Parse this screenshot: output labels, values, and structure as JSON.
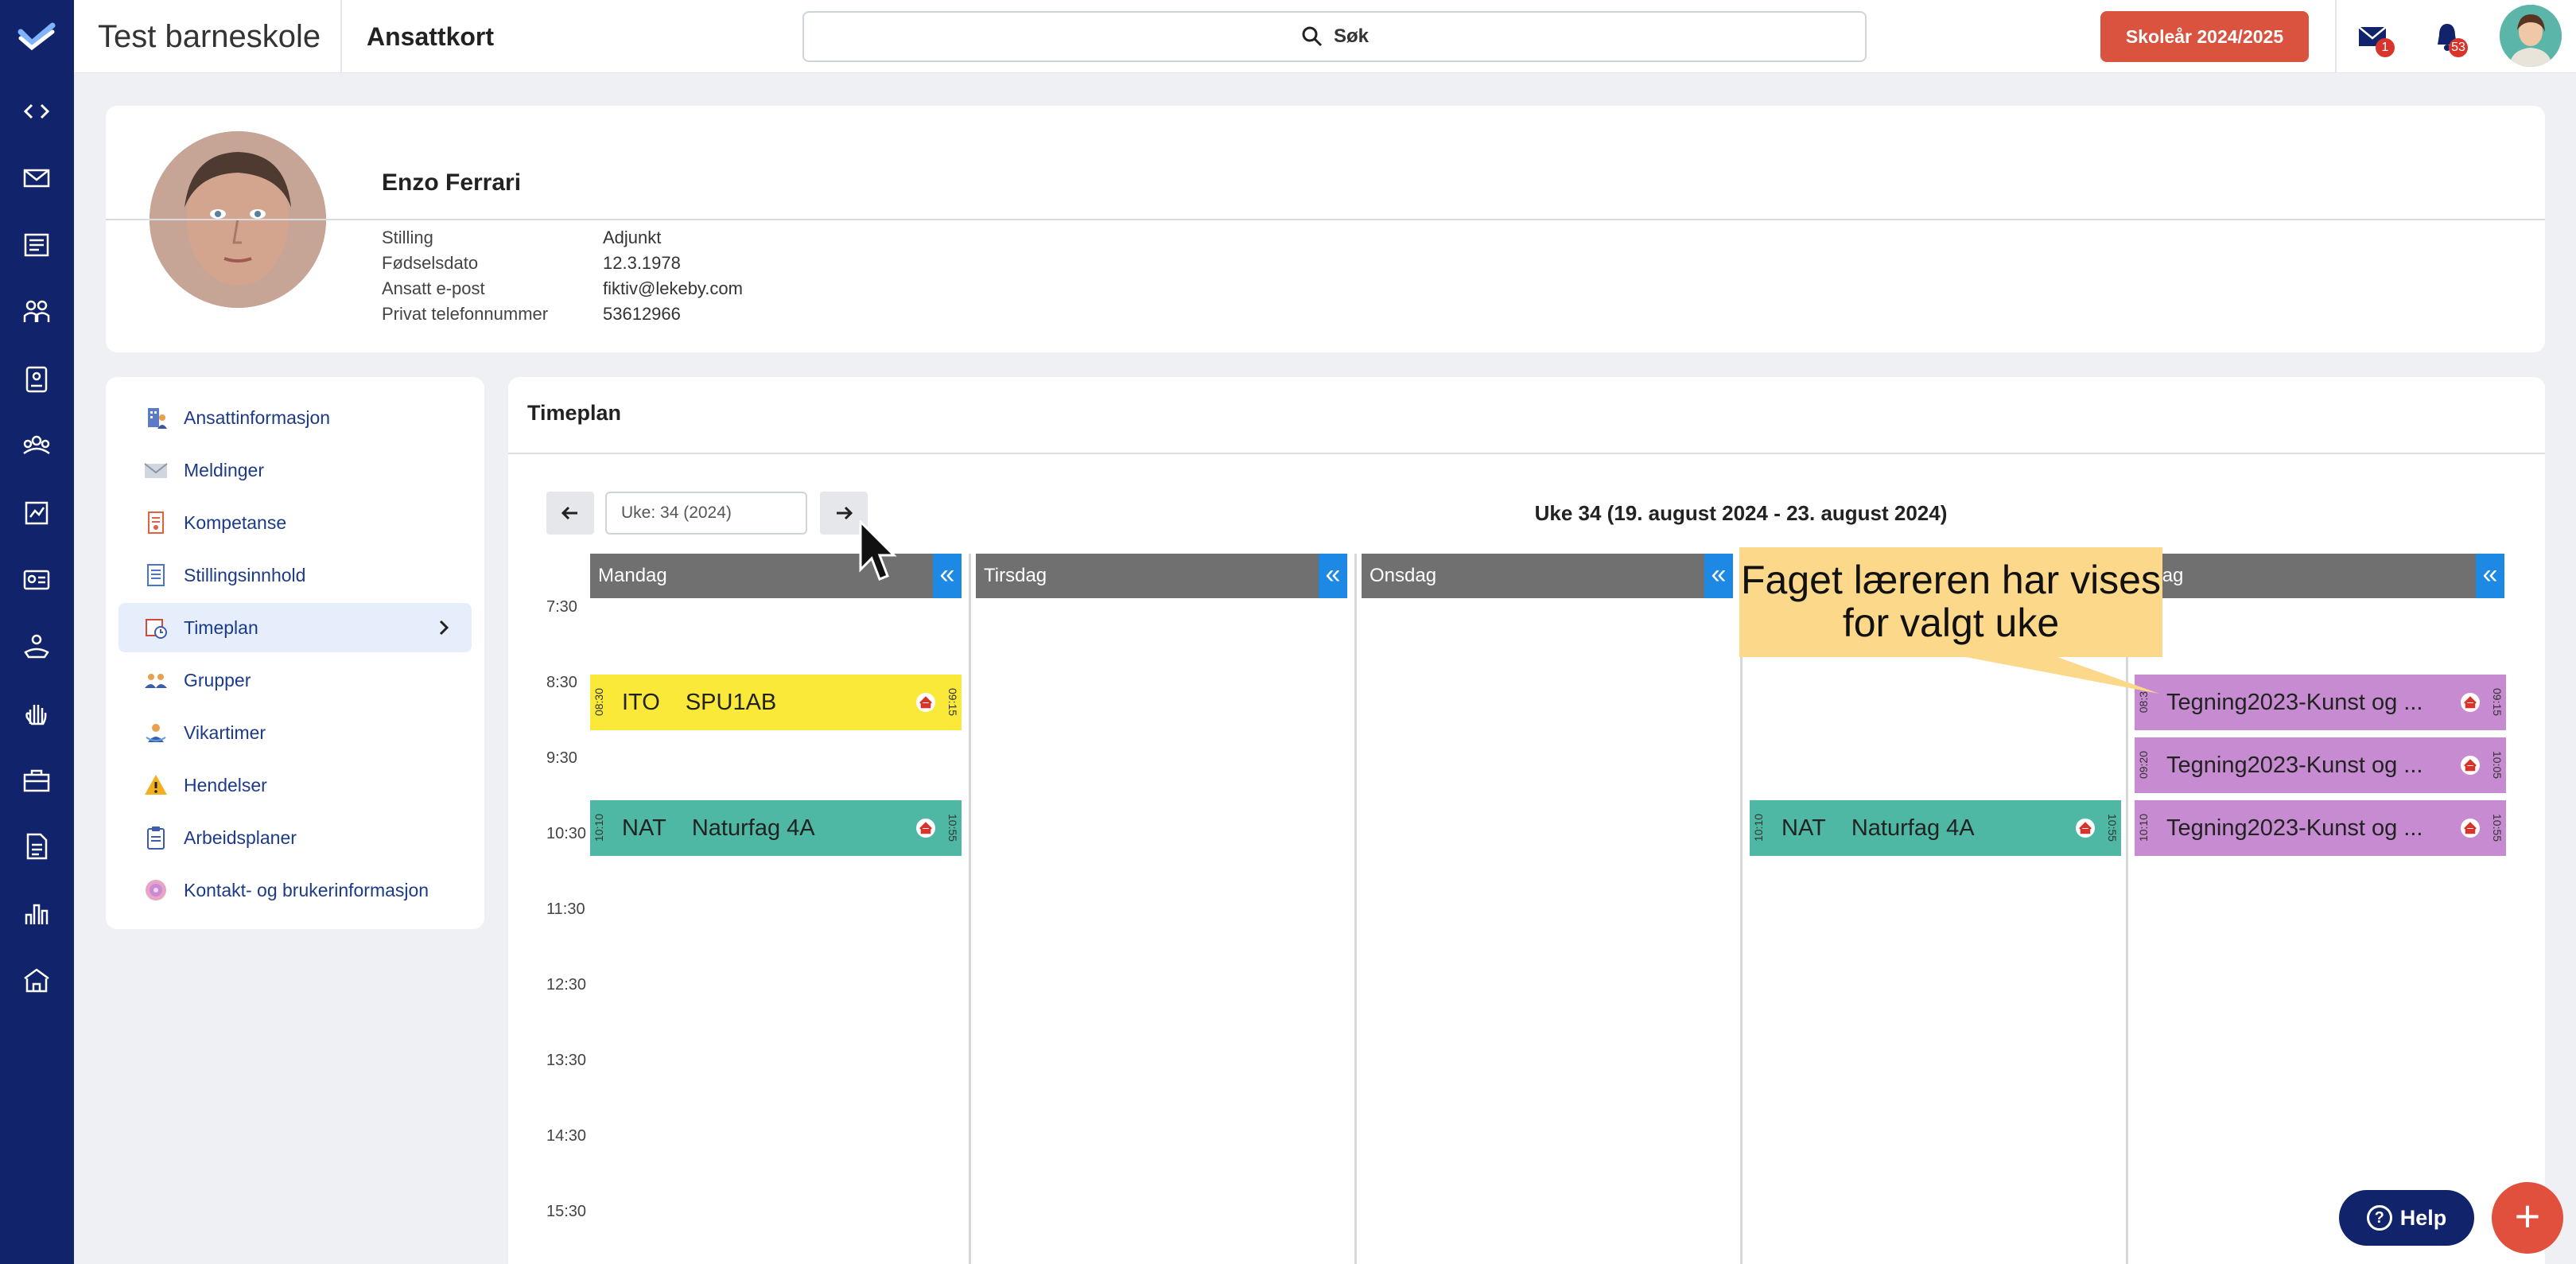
{
  "topbar": {
    "school_name": "Test barneskole",
    "breadcrumb": "Ansattkort",
    "search_label": "Søk",
    "year_button": "Skoleår 2024/2025",
    "mail_badge": "1",
    "bell_badge": "53"
  },
  "profile": {
    "name": "Enzo Ferrari",
    "fields": [
      {
        "label": "Stilling",
        "value": "Adjunkt"
      },
      {
        "label": "Fødselsdato",
        "value": "12.3.1978"
      },
      {
        "label": "Ansatt e-post",
        "value": "fiktiv@lekeby.com"
      },
      {
        "label": "Privat telefonnummer",
        "value": "53612966"
      }
    ]
  },
  "menu": {
    "items": [
      {
        "label": "Ansattinformasjon",
        "icon": "building-person-icon"
      },
      {
        "label": "Meldinger",
        "icon": "envelope-icon"
      },
      {
        "label": "Kompetanse",
        "icon": "certificate-icon"
      },
      {
        "label": "Stillingsinnhold",
        "icon": "document-list-icon"
      },
      {
        "label": "Timeplan",
        "icon": "clock-calendar-icon",
        "active": true
      },
      {
        "label": "Grupper",
        "icon": "group-icon"
      },
      {
        "label": "Vikartimer",
        "icon": "substitute-icon"
      },
      {
        "label": "Hendelser",
        "icon": "warning-icon"
      },
      {
        "label": "Arbeidsplaner",
        "icon": "clipboard-icon"
      },
      {
        "label": "Kontakt- og brukerinformasjon",
        "icon": "contact-icon"
      }
    ]
  },
  "timeplan": {
    "title": "Timeplan",
    "week_input": "Uke: 34 (2024)",
    "week_range": "Uke 34 (19. august 2024 - 23. august 2024)",
    "hours": [
      "7:30",
      "8:30",
      "9:30",
      "10:30",
      "11:30",
      "12:30",
      "13:30",
      "14:30",
      "15:30"
    ],
    "days": [
      "Mandag",
      "Tirsdag",
      "Onsdag",
      "",
      "edag"
    ],
    "lessons": [
      {
        "start": "08:30",
        "end": "09:15",
        "code": "ITO",
        "subject": "SPU1AB"
      },
      {
        "start": "10:10",
        "end": "10:55",
        "code": "NAT",
        "subject": "Naturfag 4A"
      },
      {
        "start": "10:10",
        "end": "10:55",
        "code": "NAT",
        "subject": "Naturfag 4A"
      },
      {
        "start": "08:3",
        "end": "09:15",
        "code": "",
        "subject": "Tegning2023-Kunst og ..."
      },
      {
        "start": "09:20",
        "end": "10:05",
        "code": "",
        "subject": "Tegning2023-Kunst og ..."
      },
      {
        "start": "10:10",
        "end": "10:55",
        "code": "",
        "subject": "Tegning2023-Kunst og ..."
      }
    ],
    "colors": {
      "yellow": "#fbe93a",
      "green": "#4fb8a4",
      "purple": "#c68bd0",
      "day_header": "#707070",
      "collapse": "#1e88e5"
    }
  },
  "callout": {
    "line1": "Faget læreren har vises",
    "line2": "for valgt uke"
  },
  "help_label": "Help",
  "colors": {
    "rail": "#10236b",
    "accent_red": "#d9533f"
  }
}
